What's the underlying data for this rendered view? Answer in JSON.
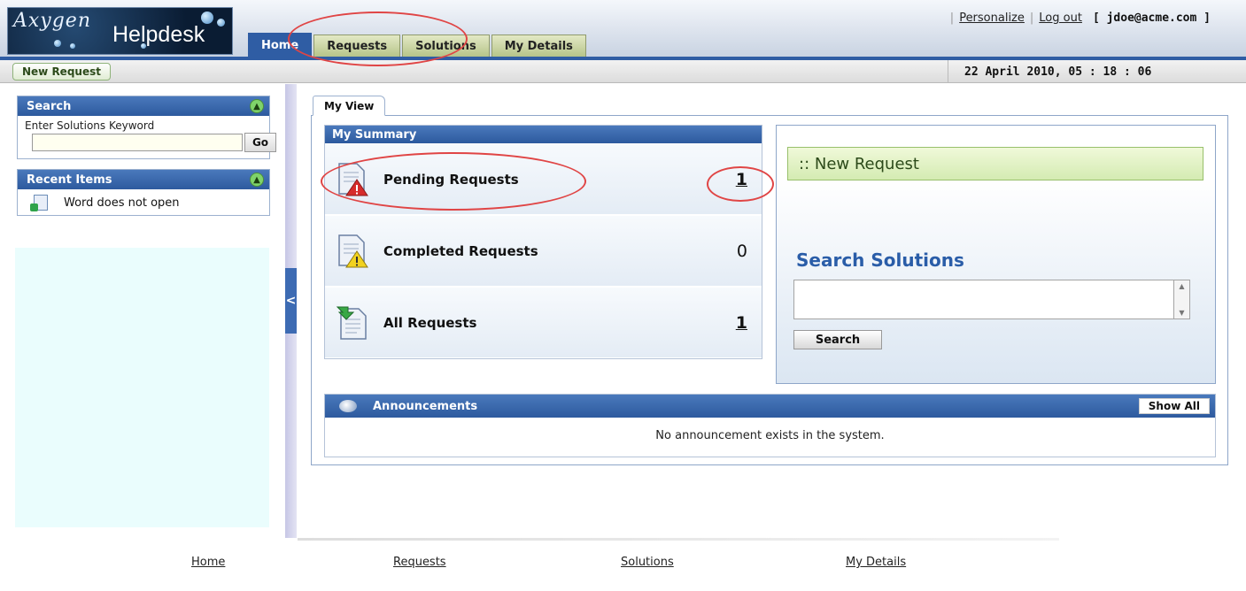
{
  "app": {
    "logo_top": "Axygen",
    "logo_bottom": "Helpdesk"
  },
  "header": {
    "links": [
      "Personalize",
      "Log out"
    ],
    "user": "[ jdoe@acme.com ]",
    "tabs": [
      {
        "label": "Home",
        "active": true
      },
      {
        "label": "Requests",
        "active": false
      },
      {
        "label": "Solutions",
        "active": false
      },
      {
        "label": "My Details",
        "active": false
      }
    ]
  },
  "subbar": {
    "new_request": "New Request",
    "datetime": "22 April 2010, 05 : 18 : 06"
  },
  "sidebar": {
    "search": {
      "title": "Search",
      "label": "Enter Solutions Keyword",
      "go": "Go"
    },
    "recent": {
      "title": "Recent Items",
      "items": [
        "Word does not open"
      ]
    }
  },
  "main": {
    "tab": "My View",
    "summary": {
      "title": "My Summary",
      "rows": [
        {
          "label": "Pending Requests",
          "count": "1"
        },
        {
          "label": "Completed Requests",
          "count": "0"
        },
        {
          "label": "All Requests",
          "count": "1"
        }
      ]
    },
    "quick": {
      "new_request": ":: New Request",
      "search_title": "Search Solutions",
      "search_button": "Search"
    },
    "announcements": {
      "title": "Announcements",
      "show_all": "Show All",
      "empty": "No announcement exists in the system."
    }
  },
  "footer": {
    "links": [
      "Home",
      "Requests",
      "Solutions",
      "My Details"
    ]
  },
  "colors": {
    "brand_blue": "#2f5da4",
    "annotation_red": "#e04545",
    "sidebar_bg": "#eafdfd"
  }
}
